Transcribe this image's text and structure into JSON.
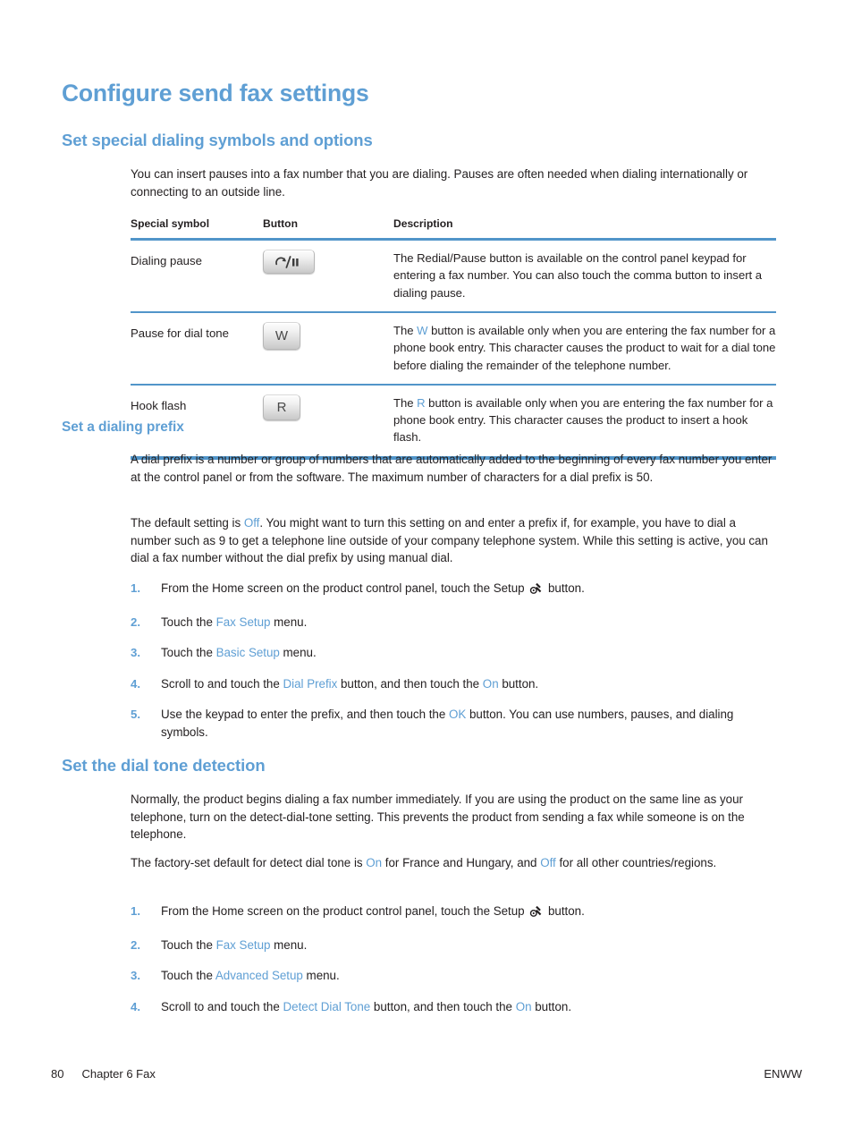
{
  "page": {
    "title": "Configure send fax settings"
  },
  "section_dialing_symbols": {
    "heading": "Set special dialing symbols and options",
    "intro": "You can insert pauses into a fax number that you are dialing. Pauses are often needed when dialing internationally or connecting to an outside line.",
    "table": {
      "headers": [
        "Special symbol",
        "Button",
        "Description"
      ],
      "rows": [
        {
          "symbol": "Dialing pause",
          "button_icon": "redial-pause-keycap",
          "button_label": "",
          "description": "The Redial/Pause button is available on the control panel keypad for entering a fax number. You can also touch the comma button to insert a dialing pause."
        },
        {
          "symbol": "Pause for dial tone",
          "button_icon": "w-keycap",
          "button_label": "W",
          "desc_prefix": "The ",
          "desc_ui": "W",
          "desc_suffix": " button is available only when you are entering the fax number for a phone book entry. This character causes the product to wait for a dial tone before dialing the remainder of the telephone number."
        },
        {
          "symbol": "Hook flash",
          "button_icon": "r-keycap",
          "button_label": "R",
          "desc_prefix": "The ",
          "desc_ui": "R",
          "desc_suffix": " button is available only when you are entering the fax number for a phone book entry. This character causes the product to insert a hook flash."
        }
      ]
    }
  },
  "section_dialing_prefix": {
    "heading": "Set a dialing prefix",
    "para1": "A dial prefix is a number or group of numbers that are automatically added to the beginning of every fax number you enter at the control panel or from the software. The maximum number of characters for a dial prefix is 50.",
    "para2_part1": "The default setting is ",
    "para2_ui1": "Off",
    "para2_part2": ". You might want to turn this setting on and enter a prefix if, for example, you have to dial a number such as 9 to get a telephone line outside of your company telephone system. While this setting is active, you can dial a fax number without the dial prefix by using manual dial.",
    "steps": [
      {
        "num": "1.",
        "part1": "From the Home screen on the product control panel, touch the Setup ",
        "icon": "setup-wrench-icon",
        "part2": " button."
      },
      {
        "num": "2.",
        "part1": "Touch the ",
        "ui": "Fax Setup",
        "part2": " menu."
      },
      {
        "num": "3.",
        "part1": "Touch the ",
        "ui": "Basic Setup",
        "part2": " menu."
      },
      {
        "num": "4.",
        "part1": "Scroll to and touch the ",
        "ui": "Dial Prefix",
        "part2": " button, and then touch the ",
        "ui2": "On",
        "part3": " button."
      },
      {
        "num": "5.",
        "part1": "Use the keypad to enter the prefix, and then touch the ",
        "ui": "OK",
        "part2": " button. You can use numbers, pauses, and dialing symbols."
      }
    ]
  },
  "section_dial_tone": {
    "heading": "Set the dial tone detection",
    "para1": "Normally, the product begins dialing a fax number immediately. If you are using the product on the same line as your telephone, turn on the detect-dial-tone setting. This prevents the product from sending a fax while someone is on the telephone.",
    "para2_part1": "The factory-set default for detect dial tone is ",
    "para2_ui1": "On",
    "para2_part2": " for France and Hungary, and ",
    "para2_ui2": "Off",
    "para2_part3": " for all other countries/regions.",
    "steps": [
      {
        "num": "1.",
        "part1": "From the Home screen on the product control panel, touch the Setup ",
        "icon": "setup-wrench-icon",
        "part2": " button."
      },
      {
        "num": "2.",
        "part1": "Touch the ",
        "ui": "Fax Setup",
        "part2": " menu."
      },
      {
        "num": "3.",
        "part1": "Touch the ",
        "ui": "Advanced Setup",
        "part2": " menu."
      },
      {
        "num": "4.",
        "part1": "Scroll to and touch the ",
        "ui": "Detect Dial Tone",
        "part2": " button, and then touch the ",
        "ui2": "On",
        "part3": " button."
      }
    ]
  },
  "footer": {
    "page_number": "80",
    "chapter": "Chapter 6  Fax",
    "right": "ENWW"
  },
  "colors": {
    "heading_blue": "#5f9fd4",
    "rule_blue": "#5195c9",
    "body_black": "#231f20"
  }
}
